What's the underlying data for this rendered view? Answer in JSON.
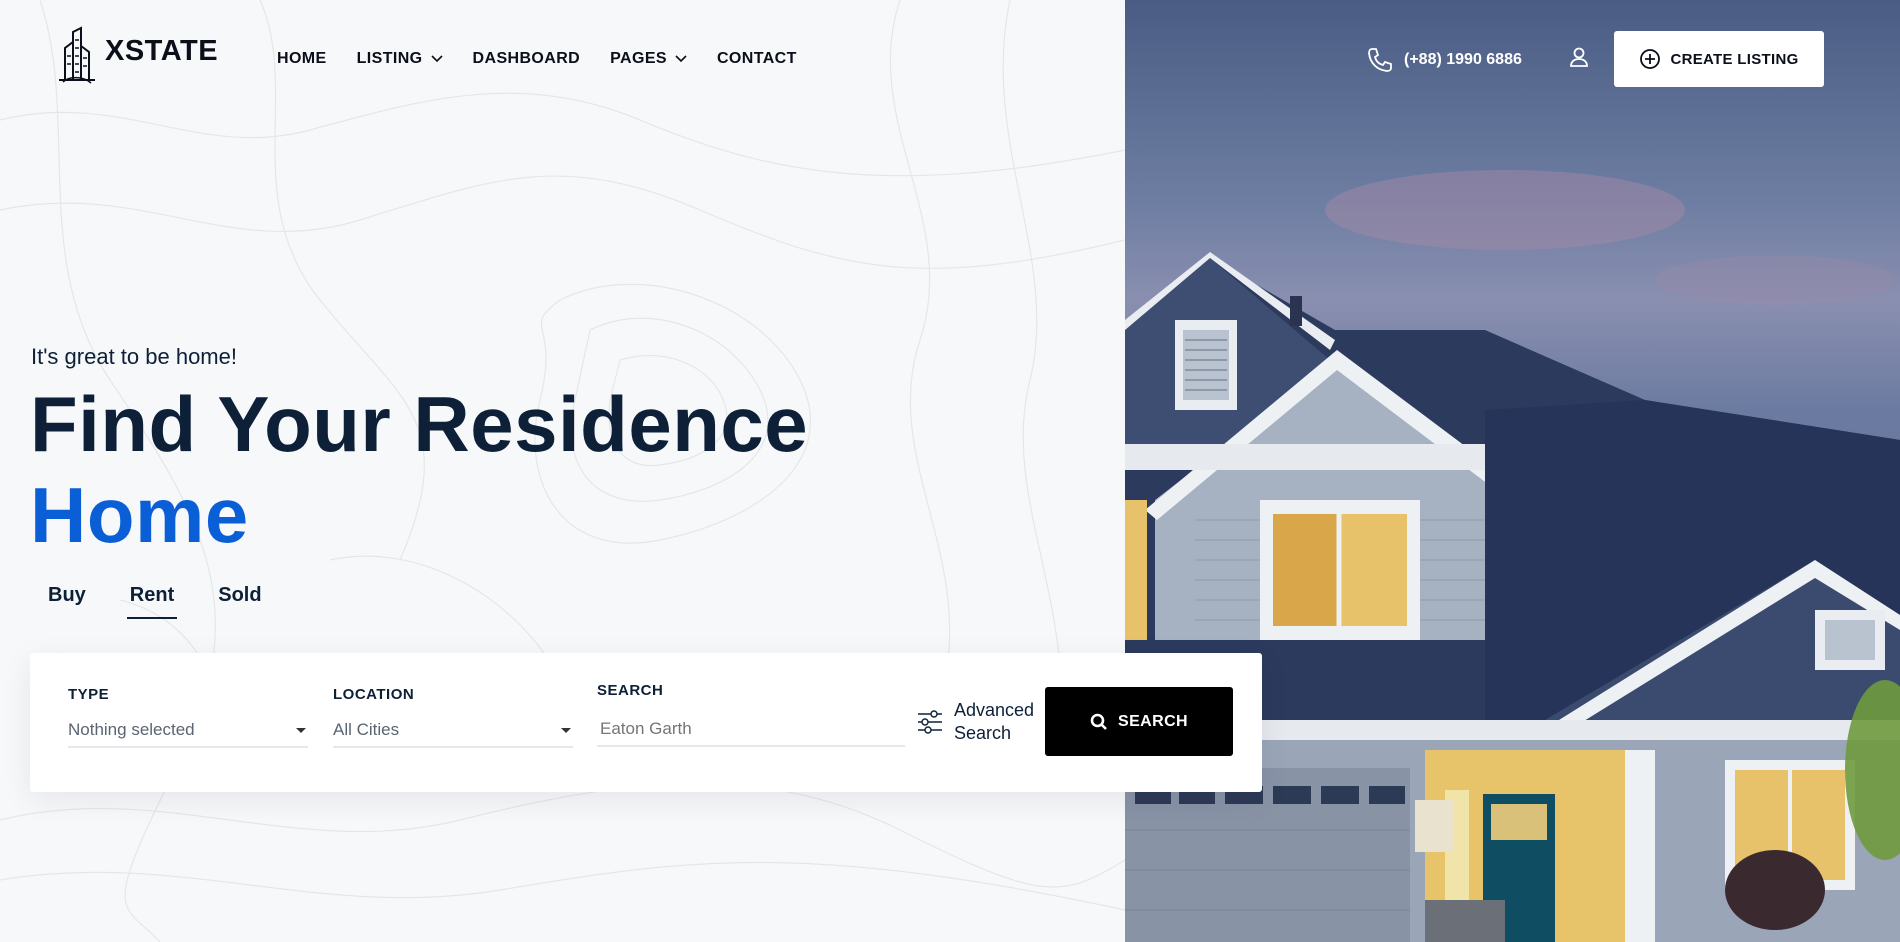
{
  "brand": {
    "name": "XSTATE"
  },
  "nav": {
    "items": [
      {
        "label": "HOME",
        "has_dropdown": false
      },
      {
        "label": "LISTING",
        "has_dropdown": true
      },
      {
        "label": "DASHBOARD",
        "has_dropdown": false
      },
      {
        "label": "PAGES",
        "has_dropdown": true
      },
      {
        "label": "CONTACT",
        "has_dropdown": false
      }
    ]
  },
  "header": {
    "phone": "(+88) 1990 6886",
    "create_listing_label": "CREATE LISTING"
  },
  "hero": {
    "tagline": "It's great to be home!",
    "headline_line1": "Find Your Residence",
    "headline_line2": "Home"
  },
  "tabs": [
    {
      "label": "Buy",
      "active": false
    },
    {
      "label": "Rent",
      "active": true
    },
    {
      "label": "Sold",
      "active": false
    }
  ],
  "search_form": {
    "type": {
      "label": "TYPE",
      "value": "Nothing selected"
    },
    "location": {
      "label": "LOCATION",
      "value": "All Cities"
    },
    "search": {
      "label": "SEARCH",
      "placeholder": "Eaton Garth"
    },
    "advanced_line1": "Advanced",
    "advanced_line2": "Search",
    "submit_label": "SEARCH"
  },
  "colors": {
    "accent": "#0b5fd6",
    "headline": "#0d2038",
    "button_dark": "#000000"
  },
  "icons": {
    "logo": "building-icon",
    "phone": "phone-icon",
    "user": "user-icon",
    "create": "plus-circle-icon",
    "advanced": "sliders-icon",
    "search": "search-icon"
  }
}
